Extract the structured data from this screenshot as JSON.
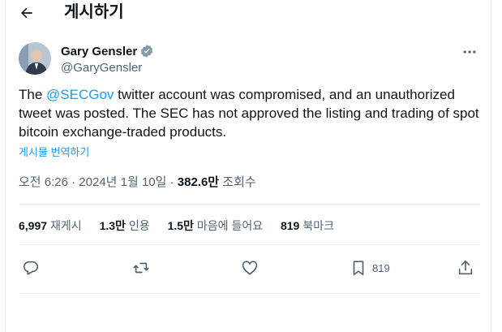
{
  "header": {
    "title": "게시하기",
    "back_icon": "arrow-left-icon"
  },
  "author": {
    "name": "Gary Gensler",
    "handle": "@GaryGensler",
    "verified": true
  },
  "tweet": {
    "prefix": "The ",
    "mention": "@SECGov",
    "body": " twitter account was compromised, and an unauthorized tweet was posted. The SEC has not approved the listing and trading of spot bitcoin exchange-traded products."
  },
  "translate_label": "게시물 번역하기",
  "meta": {
    "time_date": "오전 6:26 · 2024년 1월 10일 · ",
    "views_num": "382.6만",
    "views_label": "조회수"
  },
  "stats": [
    {
      "num": "6,997",
      "label": "재게시"
    },
    {
      "num": "1.3만",
      "label": "인용"
    },
    {
      "num": "1.5만",
      "label": "마음에 들어요"
    },
    {
      "num": "819",
      "label": "북마크"
    }
  ],
  "actions": {
    "bookmark_count": "819"
  },
  "colors": {
    "accent": "#1d9bf0",
    "muted": "#536471",
    "text": "#0f1419"
  }
}
